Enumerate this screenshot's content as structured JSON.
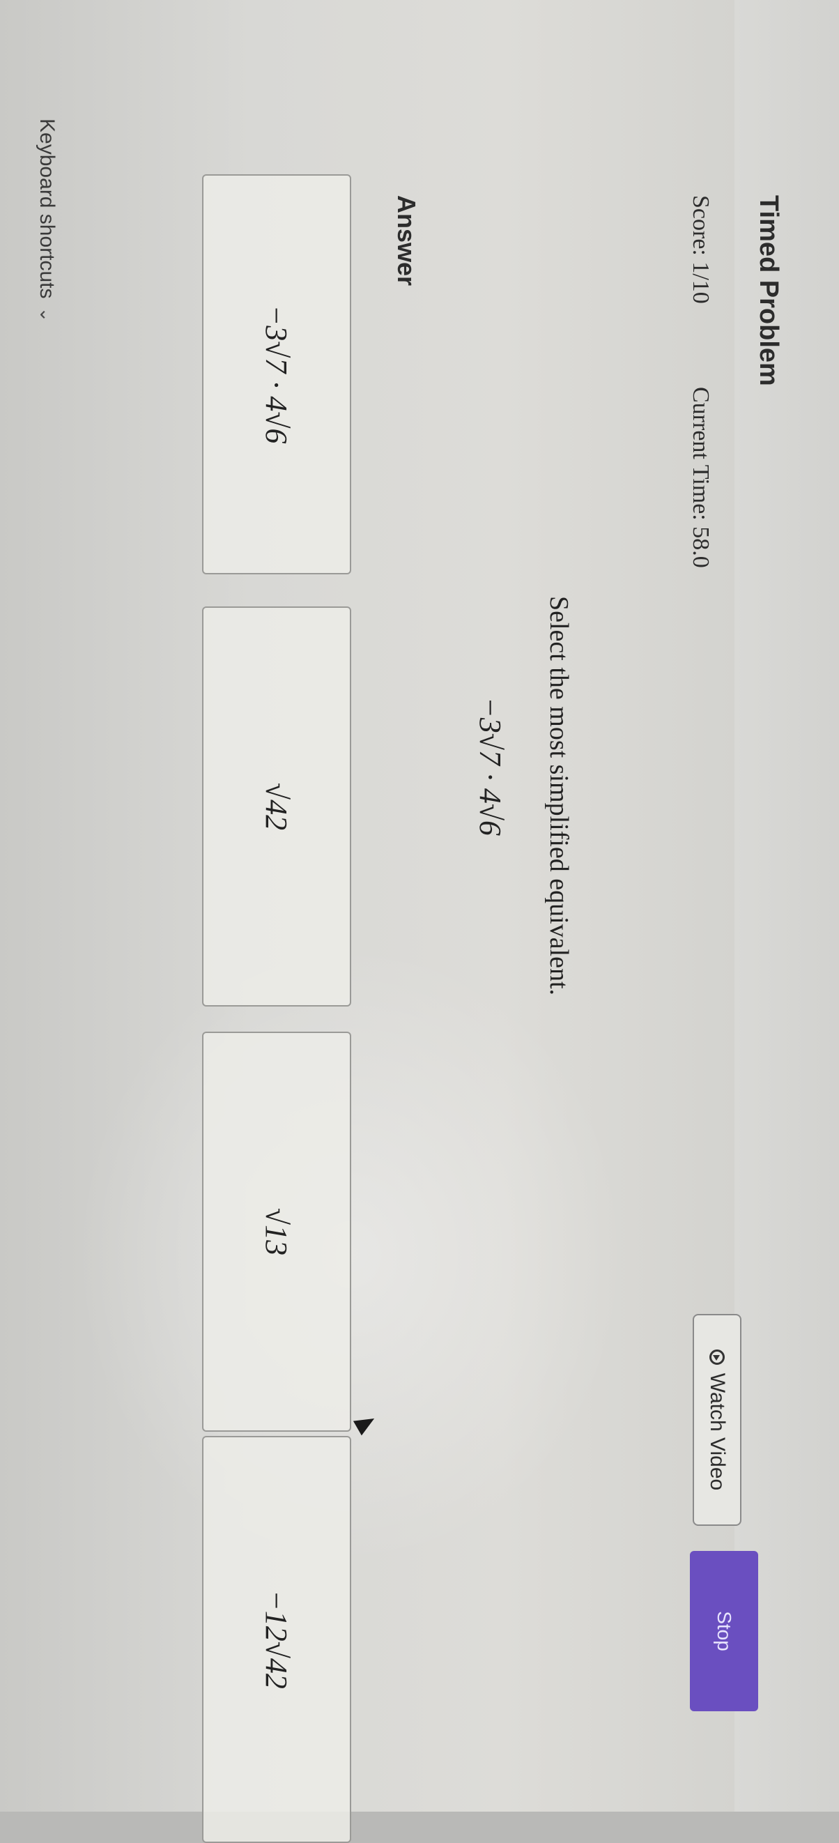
{
  "header": {
    "title": "Timed Problem",
    "score": "Score: 1/10",
    "current_time": "Current Time: 58.0",
    "watch_video_label": "Watch Video",
    "stop_label": "Stop"
  },
  "question": {
    "prompt": "Select the most simplified equivalent.",
    "expression": "−3√7 · 4√6"
  },
  "answer": {
    "label": "Answer",
    "choices": [
      {
        "text": "−3√7 · 4√6"
      },
      {
        "text": "√42"
      },
      {
        "text": "√13"
      },
      {
        "text": "−12√42"
      }
    ]
  },
  "footer": {
    "keyboard_shortcuts": "Keyboard shortcuts"
  },
  "icons": {
    "watch": "play-circle-icon",
    "keyboard_toggle": "chevron-down-icon"
  },
  "colors": {
    "stop_button": "#6a4fc0"
  }
}
